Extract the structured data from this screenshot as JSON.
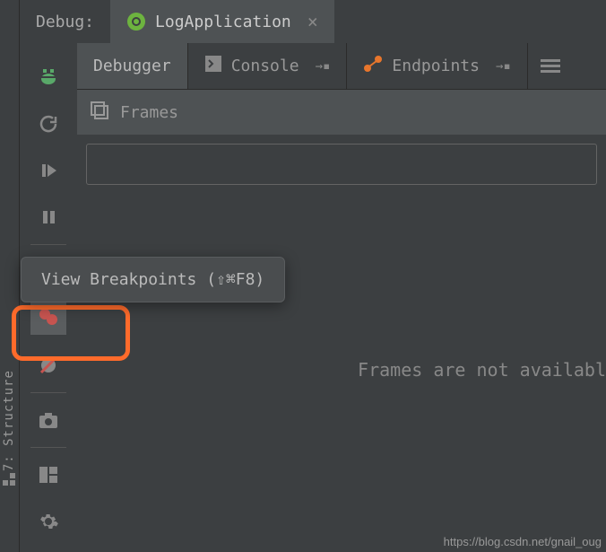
{
  "structure_panel": {
    "label": "7: Structure"
  },
  "debug_panel": {
    "label": "Debug:",
    "active_config": "LogApplication"
  },
  "panel_tabs": {
    "debugger": "Debugger",
    "console": "Console",
    "endpoints": "Endpoints"
  },
  "frames": {
    "title": "Frames",
    "empty_message": "Frames are not availabl"
  },
  "tooltip": {
    "view_breakpoints": "View Breakpoints (⇧⌘F8)"
  },
  "watermark": "https://blog.csdn.net/gnail_oug"
}
